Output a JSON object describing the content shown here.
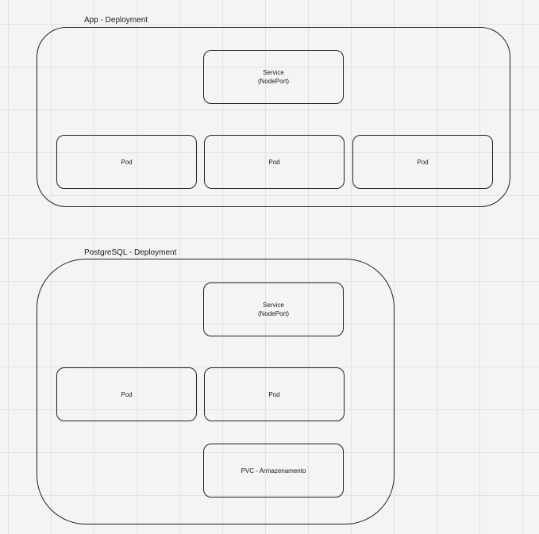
{
  "diagram": {
    "app_deployment": {
      "title": "App - Deployment",
      "service": {
        "label": "Service",
        "type": "(NodePort)"
      },
      "pods": [
        "Pod",
        "Pod",
        "Pod"
      ]
    },
    "postgres_deployment": {
      "title": "PostgreSQL - Deployment",
      "service": {
        "label": "Service",
        "type": "(NodePort)"
      },
      "pods": [
        "Pod",
        "Pod"
      ],
      "pvc": {
        "label": "PVC - Armazenamento"
      }
    }
  }
}
